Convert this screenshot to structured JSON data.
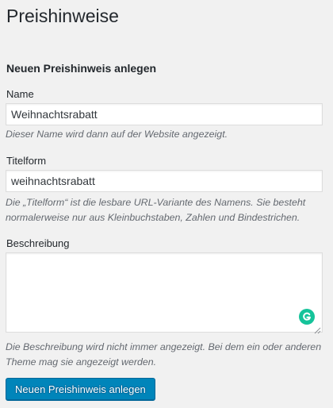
{
  "page": {
    "title": "Preishinweise"
  },
  "form": {
    "section_title": "Neuen Preishinweis anlegen",
    "name": {
      "label": "Name",
      "value": "Weihnachtsrabatt",
      "description": "Dieser Name wird dann auf der Website angezeigt."
    },
    "slug": {
      "label": "Titelform",
      "value": "weihnachtsrabatt",
      "description": "Die „Titelform“ ist die lesbare URL-Variante des Namens. Sie besteht normalerweise nur aus Kleinbuchstaben, Zahlen und Bindestrichen."
    },
    "description_field": {
      "label": "Beschreibung",
      "value": "",
      "description": "Die Beschreibung wird nicht immer angezeigt. Bei dem ein oder anderen Theme mag sie angezeigt werden."
    },
    "submit_label": "Neuen Preishinweis anlegen"
  },
  "icons": {
    "grammarly": "grammarly-icon",
    "resize": "resize-handle-icon"
  },
  "colors": {
    "primary_button": "#0085ba",
    "grammarly": "#15c39a",
    "background": "#f1f1f1"
  }
}
